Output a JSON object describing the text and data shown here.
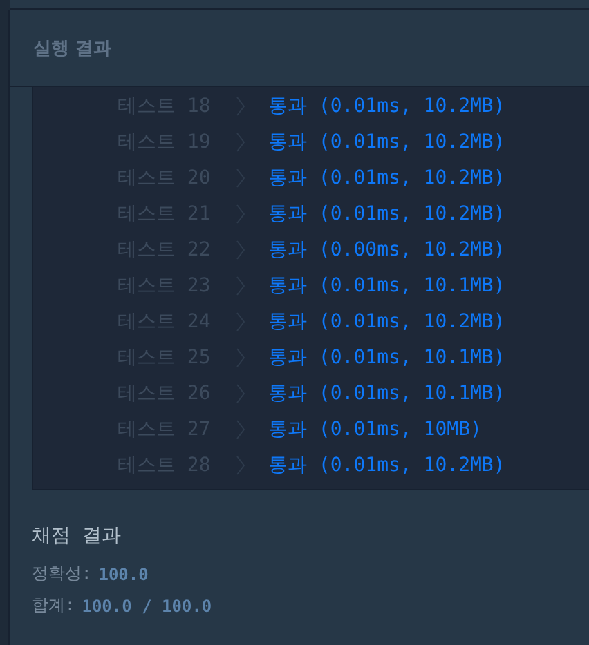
{
  "panel": {
    "title": "실행 결과"
  },
  "tests": [
    {
      "label": "테스트 18",
      "result": "통과 (0.01ms, 10.2MB)"
    },
    {
      "label": "테스트 19",
      "result": "통과 (0.01ms, 10.2MB)"
    },
    {
      "label": "테스트 20",
      "result": "통과 (0.01ms, 10.2MB)"
    },
    {
      "label": "테스트 21",
      "result": "통과 (0.01ms, 10.2MB)"
    },
    {
      "label": "테스트 22",
      "result": "통과 (0.00ms, 10.2MB)"
    },
    {
      "label": "테스트 23",
      "result": "통과 (0.01ms, 10.1MB)"
    },
    {
      "label": "테스트 24",
      "result": "통과 (0.01ms, 10.2MB)"
    },
    {
      "label": "테스트 25",
      "result": "통과 (0.01ms, 10.1MB)"
    },
    {
      "label": "테스트 26",
      "result": "통과 (0.01ms, 10.1MB)"
    },
    {
      "label": "테스트 27",
      "result": "통과 (0.01ms, 10MB)"
    },
    {
      "label": "테스트 28",
      "result": "통과 (0.01ms, 10.2MB)"
    }
  ],
  "score": {
    "title": "채점 결과",
    "lines": [
      {
        "label": "정확성:",
        "value": "100.0"
      },
      {
        "label": "합계:",
        "value": "100.0 / 100.0"
      }
    ]
  }
}
